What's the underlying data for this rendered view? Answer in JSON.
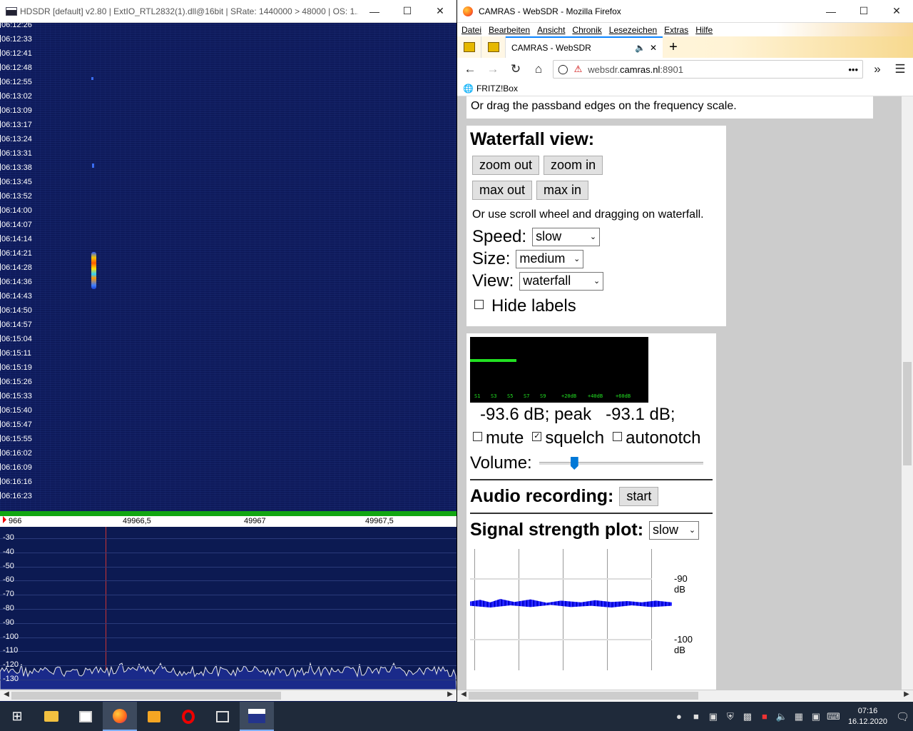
{
  "hdsdr": {
    "title": "HDSDR  [default]  v2.80  |  ExtIO_RTL2832(1).dll@16bit  |  SRate: 1440000 > 48000  |  OS: 1...",
    "times": [
      "06:12:26",
      "06:12:33",
      "06:12:41",
      "06:12:48",
      "06:12:55",
      "06:13:02",
      "06:13:09",
      "06:13:17",
      "06:13:24",
      "06:13:31",
      "06:13:38",
      "06:13:45",
      "06:13:52",
      "06:14:00",
      "06:14:07",
      "06:14:14",
      "06:14:21",
      "06:14:28",
      "06:14:36",
      "06:14:43",
      "06:14:50",
      "06:14:57",
      "06:15:04",
      "06:15:11",
      "06:15:19",
      "06:15:26",
      "06:15:33",
      "06:15:40",
      "06:15:47",
      "06:15:55",
      "06:16:02",
      "06:16:09",
      "06:16:16",
      "06:16:23"
    ],
    "freq_labels": [
      "966",
      "49966,5",
      "49967",
      "49967,5"
    ],
    "db_labels": [
      "-30",
      "-40",
      "-50",
      "-60",
      "-70",
      "-80",
      "-90",
      "-100",
      "-110",
      "-120",
      "-130"
    ]
  },
  "firefox": {
    "title": "CAMRAS - WebSDR - Mozilla Firefox",
    "menu": [
      "Datei",
      "Bearbeiten",
      "Ansicht",
      "Chronik",
      "Lesezeichen",
      "Extras",
      "Hilfe"
    ],
    "tab_title": "CAMRAS - WebSDR",
    "url_prefix": "websdr.",
    "url_domain": "camras.nl",
    "url_suffix": ":8901",
    "bookmark": "FRITZ!Box",
    "passband_hint": "Or drag the passband edges on the frequency scale.",
    "waterfall": {
      "heading": "Waterfall view:",
      "zoom_out": "zoom out",
      "zoom_in": "zoom in",
      "max_out": "max out",
      "max_in": "max in",
      "hint": "Or use scroll wheel and dragging on waterfall.",
      "speed_label": "Speed:",
      "speed_value": "slow",
      "size_label": "Size:",
      "size_value": "medium",
      "view_label": "View:",
      "view_value": "waterfall",
      "hide_labels": "Hide labels",
      "hide_labels_checked": false
    },
    "smeter": {
      "scale": [
        "S1",
        "S3",
        "S5",
        "S7",
        "S9",
        "+20dB",
        "+40dB",
        "+60dB"
      ],
      "level_text": "-93.6 dB; peak   -93.1 dB;",
      "mute": "mute",
      "mute_checked": false,
      "squelch": "squelch",
      "squelch_checked": true,
      "autonotch": "autonotch",
      "autonotch_checked": false,
      "volume_label": "Volume:",
      "volume_level": 0.2
    },
    "recording": {
      "heading": "Audio recording:",
      "button": "start"
    },
    "plot": {
      "heading": "Signal strength plot:",
      "speed": "slow",
      "labels": [
        "-90 dB",
        "-100 dB"
      ]
    }
  },
  "taskbar": {
    "time": "07:16",
    "date": "16.12.2020"
  }
}
